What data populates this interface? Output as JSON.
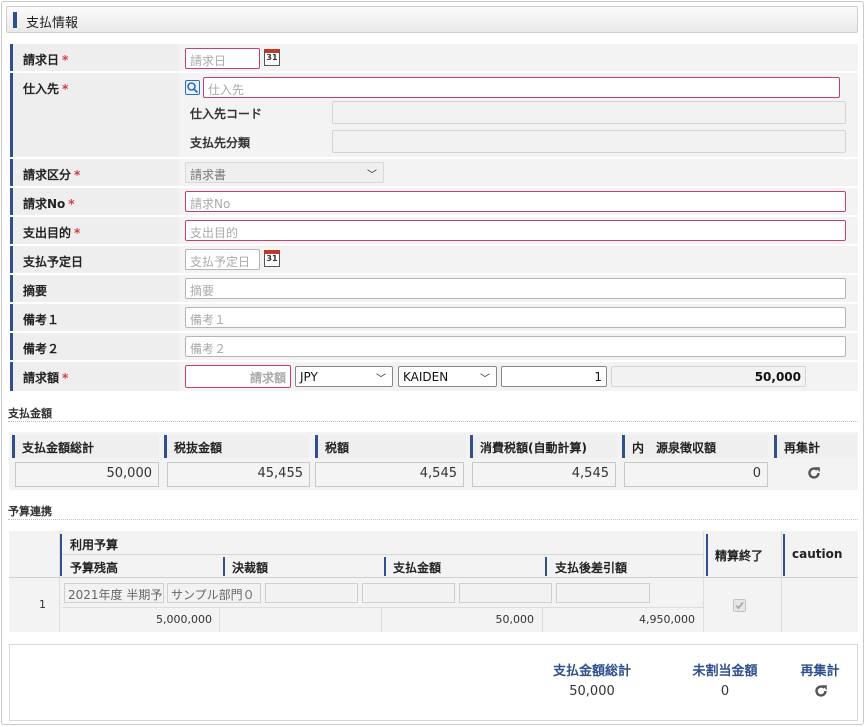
{
  "section_title": "支払情報",
  "fields": {
    "invoice_date": {
      "label": "請求日",
      "required": "*",
      "placeholder": "請求日"
    },
    "supplier": {
      "label": "仕入先",
      "required": "*",
      "placeholder": "仕入先",
      "code_label": "仕入先コード",
      "class_label": "支払先分類"
    },
    "invoice_type": {
      "label": "請求区分",
      "required": "*",
      "value": "請求書"
    },
    "invoice_no": {
      "label": "請求No",
      "required": "*",
      "placeholder": "請求No"
    },
    "purpose": {
      "label": "支出目的",
      "required": "*",
      "placeholder": "支出目的"
    },
    "payment_date": {
      "label": "支払予定日",
      "placeholder": "支払予定日"
    },
    "summary": {
      "label": "摘要",
      "placeholder": "摘要"
    },
    "note1": {
      "label": "備考１",
      "placeholder": "備考１"
    },
    "note2": {
      "label": "備考２",
      "placeholder": "備考２"
    },
    "amount": {
      "label": "請求額",
      "required": "*",
      "placeholder": "請求額",
      "currency": "JPY",
      "rate_type": "KAIDEN",
      "rate": "1",
      "converted": "50,000"
    }
  },
  "calendar_icon_text": "31",
  "payment_amount": {
    "title": "支払金額",
    "headers": [
      "支払金額総計",
      "税抜金額",
      "税額",
      "消費税額(自動計算)",
      "内　源泉徴収額",
      "再集計"
    ],
    "values": [
      "50,000",
      "45,455",
      "4,545",
      "4,545",
      "0"
    ]
  },
  "budget": {
    "title": "予算連携",
    "group_header": "利用予算",
    "headers": [
      "予算残高",
      "決裁額",
      "支払金額",
      "支払後差引額"
    ],
    "settle_header": "精算終了",
    "caution_header": "caution",
    "rows": [
      {
        "no": "1",
        "budget_name": "2021年度 半期予",
        "dept": "サンプル部門０",
        "remain": "5,000,000",
        "approved": "",
        "paid": "50,000",
        "after": "4,950,000",
        "settled": true
      }
    ]
  },
  "totals": {
    "labels": [
      "支払金額総計",
      "未割当金額",
      "再集計"
    ],
    "values": [
      "50,000",
      "0"
    ]
  },
  "colors": {
    "accent": "#2f4f8f",
    "required": "#d23b3b",
    "required_border": "#c4426a"
  }
}
